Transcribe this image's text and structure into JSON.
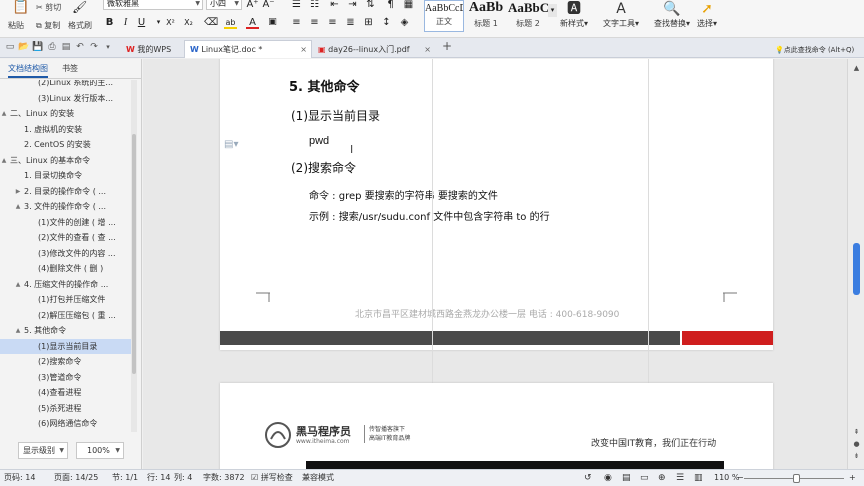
{
  "ribbon": {
    "clipboard": {
      "cut": "剪切",
      "copy": "复制",
      "paste": "粘贴",
      "format_painter": "格式刷"
    },
    "font": {
      "name": "微软雅黑",
      "size": "小四",
      "bold": "B",
      "italic": "I",
      "underline": "U",
      "superscript": "X²",
      "subscript": "X₂",
      "font_color": "A",
      "highlight": "ab"
    },
    "styles": [
      {
        "preview": "AaBbCcDd",
        "label": "正文"
      },
      {
        "preview": "AaBb",
        "label": "标题 1"
      },
      {
        "preview": "AaBbC",
        "label": "标题 2"
      }
    ],
    "new_style": "新样式",
    "text_tools": "文字工具",
    "find_replace": "查找替换",
    "select": "选择"
  },
  "tabbar": {
    "tabs": [
      {
        "label": "我的WPS",
        "active": false
      },
      {
        "label": "Linux笔记.doc *",
        "active": true
      },
      {
        "label": "day26--linux入门.pdf",
        "active": false
      }
    ],
    "add": "+",
    "close": "×",
    "search_hint": "点此查找命令 (Alt+Q)"
  },
  "nav": {
    "tabs": [
      "文档结构图",
      "书签"
    ],
    "items": [
      {
        "label": "(2)Linux 系统的主...",
        "indent": 3,
        "toggle": ""
      },
      {
        "label": "(3)Linux 发行版本...",
        "indent": 3,
        "toggle": ""
      },
      {
        "label": "二、Linux 的安装",
        "indent": 1,
        "toggle": "▲"
      },
      {
        "label": "1. 虚拟机的安装",
        "indent": 2,
        "toggle": ""
      },
      {
        "label": "2. CentOS 的安装",
        "indent": 2,
        "toggle": ""
      },
      {
        "label": "三、Linux 的基本命令",
        "indent": 1,
        "toggle": "▲"
      },
      {
        "label": "1. 目录切换命令",
        "indent": 2,
        "toggle": ""
      },
      {
        "label": "2. 目录的操作命令 ( ...",
        "indent": 2,
        "toggle": "▶"
      },
      {
        "label": "3. 文件的操作命令 ( ...",
        "indent": 2,
        "toggle": "▲"
      },
      {
        "label": "(1)文件的创建 ( 增 ...",
        "indent": 3,
        "toggle": ""
      },
      {
        "label": "(2)文件的查看 ( 查 ...",
        "indent": 3,
        "toggle": ""
      },
      {
        "label": "(3)修改文件的内容 ...",
        "indent": 3,
        "toggle": ""
      },
      {
        "label": "(4)删除文件 ( 删 )",
        "indent": 3,
        "toggle": ""
      },
      {
        "label": "4. 压缩文件的操作命 ...",
        "indent": 2,
        "toggle": "▲"
      },
      {
        "label": "(1)打包并压缩文件",
        "indent": 3,
        "toggle": ""
      },
      {
        "label": "(2)解压压缩包 ( 重 ...",
        "indent": 3,
        "toggle": ""
      },
      {
        "label": "5. 其他命令",
        "indent": 2,
        "toggle": "▲"
      },
      {
        "label": "(1)显示当前目录",
        "indent": 3,
        "toggle": "",
        "selected": true
      },
      {
        "label": "(2)搜索命令",
        "indent": 3,
        "toggle": ""
      },
      {
        "label": "(3)管道命令",
        "indent": 3,
        "toggle": ""
      },
      {
        "label": "(4)查看进程",
        "indent": 3,
        "toggle": ""
      },
      {
        "label": "(5)杀死进程",
        "indent": 3,
        "toggle": ""
      },
      {
        "label": "(6)网络通信命令",
        "indent": 3,
        "toggle": ""
      }
    ],
    "level_select": "显示级别",
    "zoom_select": "100%"
  },
  "document": {
    "heading": "5. 其他命令",
    "sub1": "(1)显示当前目录",
    "cmd1": "pwd",
    "sub2": "(2)搜索命令",
    "line1": "命令 : grep  要搜索的字符串  要搜索的文件",
    "line2": "示例 : 搜索/usr/sudu.conf 文件中包含字符串 to 的行",
    "footer": "北京市昌平区建材城西路金燕龙办公楼一层      电话 : 400-618-9090",
    "logo_main": "黑马程序员",
    "logo_url": "www.itheima.com",
    "logo_slogan1": "传智播客旗下",
    "logo_slogan2": "高端IT教育品牌",
    "slogan": "改变中国IT教育，我们正在行动"
  },
  "status": {
    "page_num": "页码: 14",
    "page": "页面: 14/25",
    "section": "节: 1/1",
    "row": "行: 14",
    "col": "列: 4",
    "words": "字数: 3872",
    "spell": "拼写检查",
    "mode": "兼容模式",
    "zoom": "110 %"
  },
  "colors": {
    "accent": "#3b7de0",
    "selection": "#c9daf4",
    "footer_red": "#cf1e1e"
  }
}
